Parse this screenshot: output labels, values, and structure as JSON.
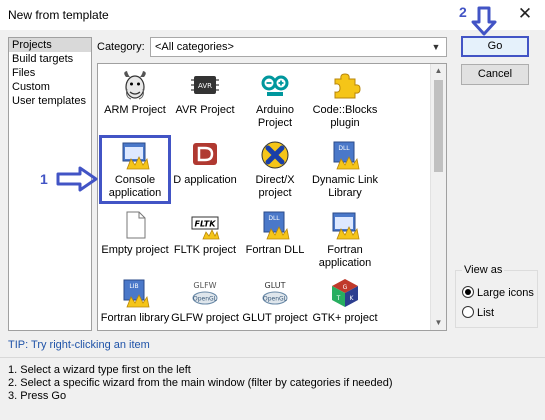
{
  "window": {
    "title": "New from template",
    "close_glyph": "✕"
  },
  "left_list": {
    "items": [
      "Projects",
      "Build targets",
      "Files",
      "Custom",
      "User templates"
    ],
    "selected": 0
  },
  "category": {
    "label": "Category:",
    "value": "<All categories>"
  },
  "templates": [
    {
      "label": "ARM Project",
      "icon": "gnu-icon"
    },
    {
      "label": "AVR Project",
      "icon": "avr-chip-icon"
    },
    {
      "label": "Arduino Project",
      "icon": "arduino-icon"
    },
    {
      "label": "Code::Blocks plugin",
      "icon": "puzzle-icon"
    },
    {
      "label": "Console application",
      "icon": "console-app-icon"
    },
    {
      "label": "D application",
      "icon": "d-lang-icon"
    },
    {
      "label": "Direct/X project",
      "icon": "directx-icon"
    },
    {
      "label": "Dynamic Link Library",
      "icon": "dll-icon"
    },
    {
      "label": "Empty project",
      "icon": "blank-page-icon"
    },
    {
      "label": "FLTK project",
      "icon": "fltk-icon"
    },
    {
      "label": "Fortran DLL",
      "icon": "fortran-dll-icon"
    },
    {
      "label": "Fortran application",
      "icon": "fortran-app-icon"
    },
    {
      "label": "Fortran library",
      "icon": "fortran-lib-icon"
    },
    {
      "label": "GLFW project",
      "icon": "glfw-icon"
    },
    {
      "label": "GLUT project",
      "icon": "glut-icon"
    },
    {
      "label": "GTK+ project",
      "icon": "gtk-icon"
    }
  ],
  "selected_template": "Console application",
  "buttons": {
    "go": "Go",
    "cancel": "Cancel"
  },
  "annotations": {
    "step1": "1",
    "step2": "2"
  },
  "view_as": {
    "legend": "View as",
    "options": [
      "Large icons",
      "List"
    ],
    "selected": 0
  },
  "tip": "TIP: Try right-clicking an item",
  "instructions": [
    "1. Select a wizard type first on the left",
    "2. Select a specific wizard from the main window (filter by categories if needed)",
    "3. Press Go"
  ],
  "colors": {
    "annotation_blue": "#4254c5",
    "tip_blue": "#1f53a8"
  }
}
